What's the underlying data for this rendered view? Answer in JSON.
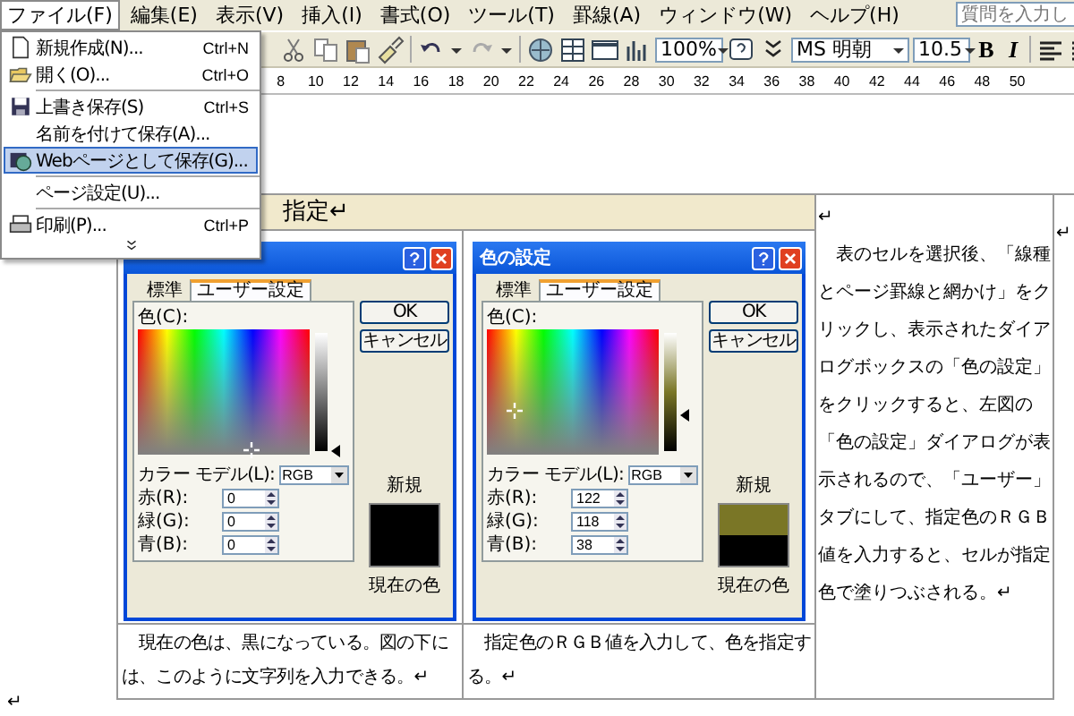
{
  "menu_bar": {
    "items": [
      {
        "label": "ファイル(F)",
        "selected": true
      },
      {
        "label": "編集(E)",
        "selected": false
      },
      {
        "label": "表示(V)",
        "selected": false
      },
      {
        "label": "挿入(I)",
        "selected": false
      },
      {
        "label": "書式(O)",
        "selected": false
      },
      {
        "label": "ツール(T)",
        "selected": false
      },
      {
        "label": "罫線(A)",
        "selected": false
      },
      {
        "label": "ウィンドウ(W)",
        "selected": false
      },
      {
        "label": "ヘルプ(H)",
        "selected": false
      }
    ],
    "question_box": {
      "placeholder": "質問を入力し"
    }
  },
  "toolbar": {
    "zoom": "100%",
    "font": "MS 明朝",
    "font_size": "10.5",
    "bold": "B",
    "italic": "I"
  },
  "ruler": {
    "numbers": [
      "8",
      "10",
      "12",
      "14",
      "16",
      "18",
      "20",
      "22",
      "24",
      "26",
      "28",
      "30",
      "32",
      "34",
      "36",
      "38",
      "40",
      "42",
      "44",
      "46",
      "48",
      "50"
    ]
  },
  "file_menu": {
    "items": [
      {
        "kind": "item",
        "label": "新規作成(N)...",
        "shortcut": "Ctrl+N",
        "selected": false
      },
      {
        "kind": "item",
        "label": "開く(O)...",
        "shortcut": "Ctrl+O",
        "selected": false
      },
      {
        "kind": "separator"
      },
      {
        "kind": "item",
        "label": "上書き保存(S)",
        "shortcut": "Ctrl+S",
        "selected": false
      },
      {
        "kind": "item",
        "label": "名前を付けて保存(A)...",
        "selected": false
      },
      {
        "kind": "item",
        "label": "Webページとして保存(G)...",
        "selected": true
      },
      {
        "kind": "separator"
      },
      {
        "kind": "item",
        "label": "ページ設定(U)...",
        "selected": false
      },
      {
        "kind": "separator"
      },
      {
        "kind": "item",
        "label": "印刷(P)...",
        "shortcut": "Ctrl+P",
        "selected": false
      }
    ]
  },
  "document": {
    "heading": "指定↵",
    "figures": [
      {
        "tabs": [
          {
            "label": "標準",
            "selected": false
          },
          {
            "label": "ユーザー設定",
            "selected": true
          }
        ],
        "color_label": "色(C):",
        "model_label": "カラー モデル(L):",
        "model": "RGB",
        "channels": [
          {
            "label": "赤(R):",
            "value": "0"
          },
          {
            "label": "緑(G):",
            "value": "0"
          },
          {
            "label": "青(B):",
            "value": "0"
          }
        ],
        "ok": "OK",
        "cancel": "キャンセル",
        "new_label": "新規",
        "current_label": "現在の色",
        "new_swatch": {
          "color": "#000000"
        },
        "current_swatch": {
          "color": "#000000"
        },
        "luminance": {
          "level": 0.0
        }
      },
      {
        "title": "色の設定",
        "tabs": [
          {
            "label": "標準",
            "selected": false
          },
          {
            "label": "ユーザー設定",
            "selected": true
          }
        ],
        "color_label": "色(C):",
        "model_label": "カラー モデル(L):",
        "model": "RGB",
        "channels": [
          {
            "label": "赤(R):",
            "value": "122"
          },
          {
            "label": "緑(G):",
            "value": "118"
          },
          {
            "label": "青(B):",
            "value": "38"
          }
        ],
        "ok": "OK",
        "cancel": "キャンセル",
        "new_label": "新規",
        "current_label": "現在の色",
        "new_swatch": {
          "color": "#7a7626"
        },
        "current_swatch": {
          "color": "#000000"
        },
        "luminance": {
          "level": 0.3
        }
      }
    ],
    "captions": [
      "　現在の色は、黒になっている。図の下には、このように文字列を入力できる。↵",
      "　指定色のＲＧＢ値を入力して、色を指定する。↵"
    ],
    "side_mark": "↵",
    "side_paragraph": "　表のセルを選択後、「線種とページ罫線と網かけ」をクリックし、表示されたダイアログボックスの「色の設定」をクリックすると、左図の「色の設定」ダイアログが表示されるので、「ユーザー」タブにして、指定色のＲＧＢ値を入力すると、セルが指定色で塗りつぶされる。↵",
    "row_mark": "↵",
    "end_mark": "↵"
  }
}
